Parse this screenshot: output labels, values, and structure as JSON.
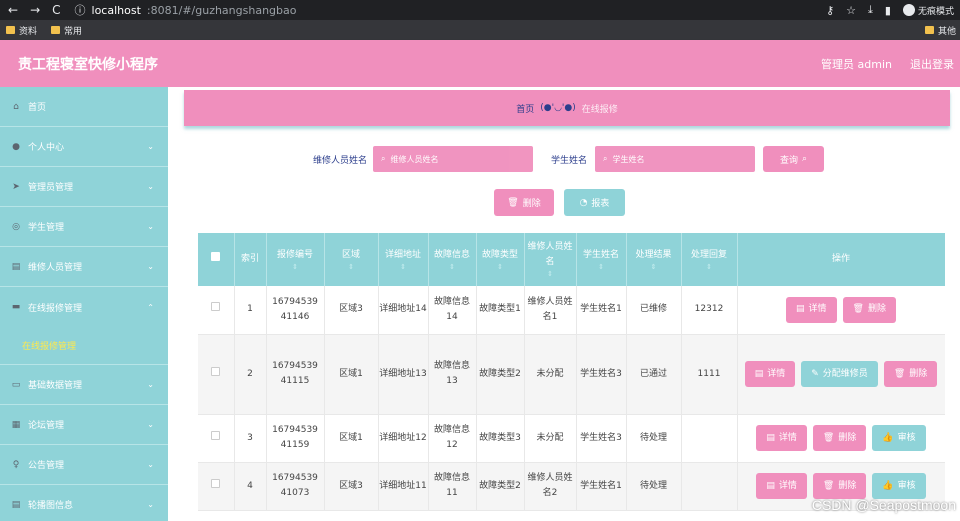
{
  "browser": {
    "host": "localhost",
    "path": ":8081/#/guzhangshangbao",
    "incognito_label": "无痕模式",
    "bookmarks": [
      "资料",
      "常用"
    ],
    "bookmark_right": "其他"
  },
  "header": {
    "title": "责工程寝室快修小程序",
    "user": "管理员 admin",
    "logout": "退出登录"
  },
  "sidebar": {
    "items": [
      {
        "label": "首页",
        "icon": "home-icon"
      },
      {
        "label": "个人中心",
        "icon": "user-icon"
      },
      {
        "label": "管理员管理",
        "icon": "send-icon"
      },
      {
        "label": "学生管理",
        "icon": "globe-icon"
      },
      {
        "label": "维修人员管理",
        "icon": "clipboard-icon"
      },
      {
        "label": "在线报修管理",
        "icon": "chat-icon"
      },
      {
        "label": "基础数据管理",
        "icon": "monitor-icon"
      },
      {
        "label": "论坛管理",
        "icon": "grid-icon"
      },
      {
        "label": "公告管理",
        "icon": "mic-icon"
      },
      {
        "label": "轮播图信息",
        "icon": "clipboard-icon"
      }
    ],
    "subitem": "在线报修管理"
  },
  "breadcrumb": {
    "home": "首页",
    "emoji": "(●'◡'●)",
    "current": "在线报修"
  },
  "search": {
    "repairer_label": "维修人员姓名",
    "repairer_placeholder": "维修人员姓名",
    "student_label": "学生姓名",
    "student_placeholder": "学生姓名",
    "query_button": "查询"
  },
  "actions": {
    "delete": "删除",
    "report": "报表"
  },
  "table": {
    "headers": [
      "索引",
      "报修编号",
      "区域",
      "详细地址",
      "故障信息",
      "故障类型",
      "维修人员姓名",
      "学生姓名",
      "处理结果",
      "处理回复",
      "操作"
    ],
    "rows": [
      {
        "idx": "1",
        "no": "1679453941146",
        "area": "区域3",
        "addr": "详细地址14",
        "info": "故障信息14",
        "type": "故障类型1",
        "repairer": "维修人员姓名1",
        "student": "学生姓名1",
        "result": "已维修",
        "reply": "12312",
        "ops": [
          "详情",
          "删除"
        ]
      },
      {
        "idx": "2",
        "no": "1679453941115",
        "area": "区域1",
        "addr": "详细地址13",
        "info": "故障信息13",
        "type": "故障类型2",
        "repairer": "未分配",
        "student": "学生姓名3",
        "result": "已通过",
        "reply": "1111",
        "ops": [
          "详情",
          "分配维修员",
          "删除"
        ]
      },
      {
        "idx": "3",
        "no": "1679453941159",
        "area": "区域1",
        "addr": "详细地址12",
        "info": "故障信息12",
        "type": "故障类型3",
        "repairer": "未分配",
        "student": "学生姓名3",
        "result": "待处理",
        "reply": "",
        "ops": [
          "详情",
          "删除",
          "审核"
        ]
      },
      {
        "idx": "4",
        "no": "1679453941073",
        "area": "区域3",
        "addr": "详细地址11",
        "info": "故障信息11",
        "type": "故障类型2",
        "repairer": "维修人员姓名2",
        "student": "学生姓名1",
        "result": "待处理",
        "reply": "",
        "ops": [
          "详情",
          "删除",
          "审核"
        ]
      }
    ]
  },
  "watermark": "CSDN @Seapostmoon",
  "colors": {
    "pink": "#f08fbd",
    "teal": "#8fd3d8",
    "yellow": "#ffe94d",
    "navy": "#2c3e8c"
  }
}
